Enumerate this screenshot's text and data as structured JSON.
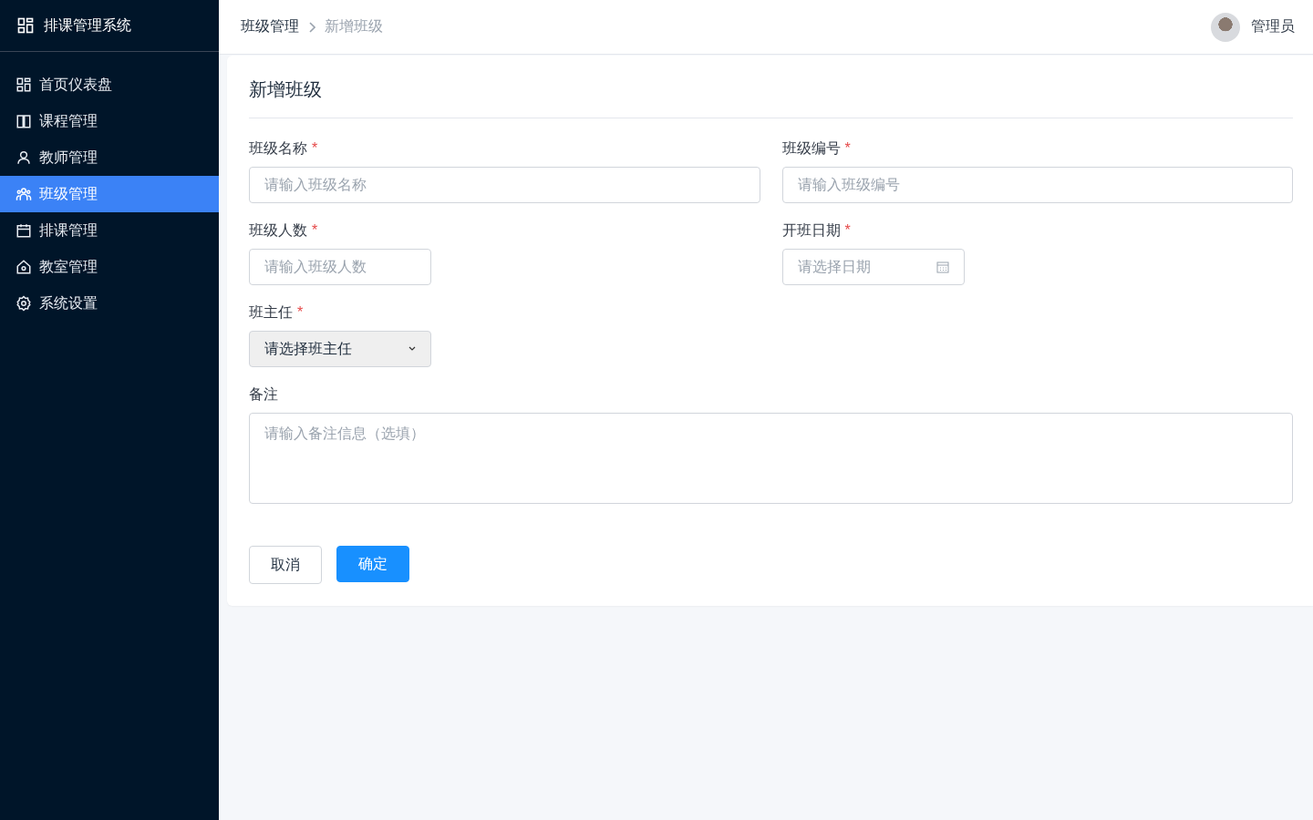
{
  "sidebar": {
    "title": "排课管理系统",
    "items": [
      {
        "label": "首页仪表盘",
        "kind": "dashboard",
        "selected": false
      },
      {
        "label": "课程管理",
        "kind": "book",
        "selected": false
      },
      {
        "label": "教师管理",
        "kind": "person",
        "selected": false
      },
      {
        "label": "班级管理",
        "kind": "group",
        "selected": true
      },
      {
        "label": "排课管理",
        "kind": "calendar",
        "selected": false
      },
      {
        "label": "教室管理",
        "kind": "home",
        "selected": false
      },
      {
        "label": "系统设置",
        "kind": "gear",
        "selected": false
      }
    ]
  },
  "header": {
    "breadcrumb": [
      "班级管理",
      "新增班级"
    ],
    "user": "管理员"
  },
  "form": {
    "title": "新增班级",
    "rows": [
      [
        {
          "kind": "text",
          "label": "班级名称",
          "required_mark": "*",
          "placeholder": "请输入班级名称"
        },
        {
          "kind": "text",
          "label": "班级编号",
          "required_mark": "*",
          "placeholder": "请输入班级编号"
        }
      ],
      [
        {
          "kind": "number",
          "label": "班级人数",
          "required_mark": "*",
          "placeholder": "请输入班级人数"
        },
        {
          "kind": "date",
          "label": "开班日期",
          "required_mark": "*",
          "placeholder": "请选择日期"
        }
      ],
      [
        {
          "kind": "select",
          "label": "班主任",
          "required_mark": "*",
          "value": "请选择班主任"
        }
      ],
      [
        {
          "kind": "textarea",
          "label": "备注",
          "placeholder": "请输入备注信息（选填）"
        }
      ]
    ],
    "buttons": [
      {
        "label": "取消",
        "kind": "default"
      },
      {
        "label": "确定",
        "kind": "primary"
      }
    ]
  }
}
